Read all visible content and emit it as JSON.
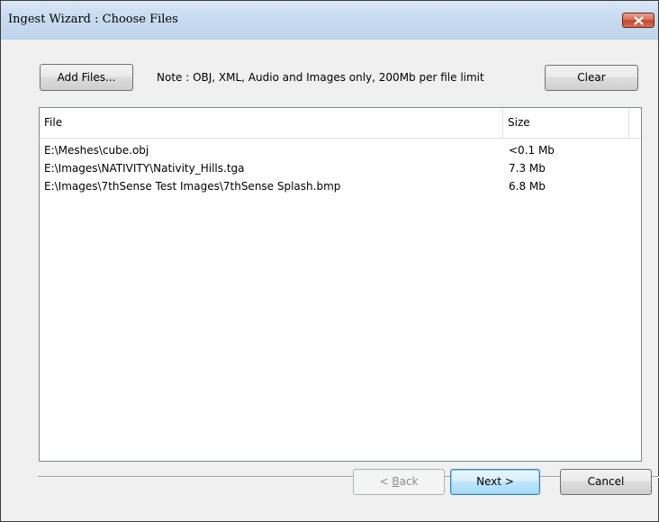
{
  "window": {
    "title": "Ingest Wizard : Choose Files"
  },
  "toolbar": {
    "add_files_label": "Add Files...",
    "note": "Note : OBJ, XML, Audio and Images only, 200Mb per file limit",
    "clear_label": "Clear"
  },
  "file_list": {
    "columns": [
      "File",
      "Size"
    ],
    "rows": [
      {
        "file": "E:\\Meshes\\cube.obj",
        "size": "<0.1 Mb"
      },
      {
        "file": "E:\\Images\\NATIVITY\\Nativity_Hills.tga",
        "size": "7.3 Mb"
      },
      {
        "file": "E:\\Images\\7thSense Test Images\\7thSense Splash.bmp",
        "size": "6.8 Mb"
      }
    ]
  },
  "footer": {
    "back_prefix": "< ",
    "back_accel": "B",
    "back_rest": "ack",
    "next_label": "Next >",
    "cancel_label": "Cancel"
  },
  "icons": {
    "close": "close-icon"
  },
  "colors": {
    "title_bar": "#c9dcf0",
    "close_button": "#c4462c",
    "dialog_background": "#f0f0f0",
    "default_button_border": "#3c7fb1"
  }
}
